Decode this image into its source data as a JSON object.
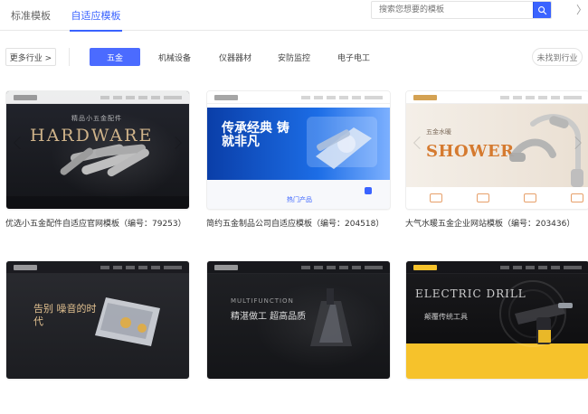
{
  "tabs": [
    {
      "label": "标准模板",
      "active": false
    },
    {
      "label": "自适应模板",
      "active": true
    }
  ],
  "search": {
    "placeholder": "搜索您想要的模板"
  },
  "close_label": "〉",
  "filters": {
    "more_label": "更多行业 >",
    "categories": [
      {
        "label": "五金",
        "active": true
      },
      {
        "label": "机械设备",
        "active": false
      },
      {
        "label": "仪器器材",
        "active": false
      },
      {
        "label": "安防监控",
        "active": false
      },
      {
        "label": "电子电工",
        "active": false
      }
    ],
    "not_found_label": "未找到行业"
  },
  "templates": [
    {
      "caption": "优选小五金配件自适应官网模板（编号：79253）",
      "hero_text": "HARDWARE",
      "hero_subtitle": "精品小五金配件"
    },
    {
      "caption": "简约五金制品公司自适应模板（编号：204518）",
      "hero_text": "传承经典 铸就非凡",
      "hero_badge": "热门产品"
    },
    {
      "caption": "大气水暖五金企业网站模板（编号：203436）",
      "hero_text": "SHOWER",
      "hero_subtitle": "五金水暖"
    },
    {
      "caption": "",
      "hero_text": "告别 噪音的时代"
    },
    {
      "caption": "",
      "hero_text": "MULTIFUNCTION",
      "hero_subtitle": "精湛做工 超高品质"
    },
    {
      "caption": "",
      "hero_text": "ELECTRIC DRILL",
      "hero_subtitle": "颠覆传统工具"
    }
  ],
  "colors": {
    "accent": "#3a63ff",
    "active_chip": "#4b6bff"
  }
}
